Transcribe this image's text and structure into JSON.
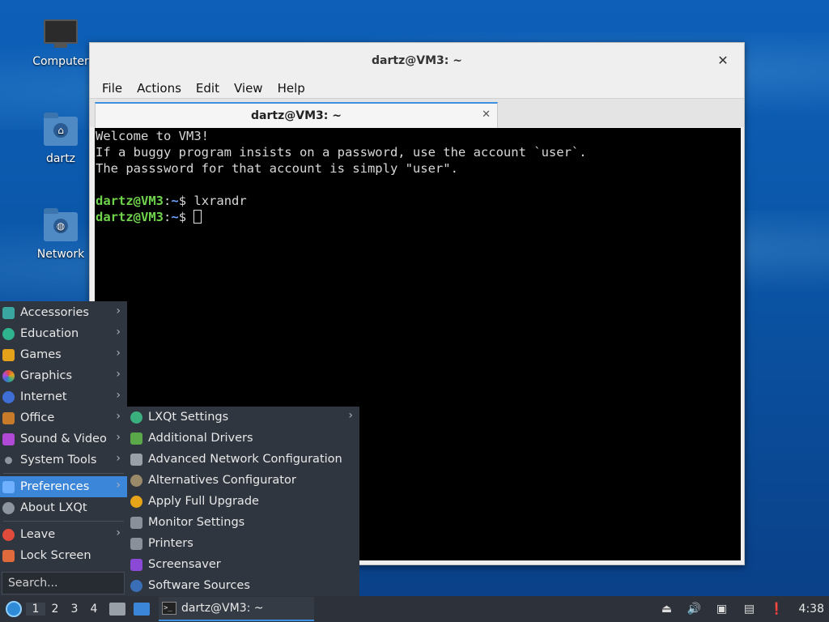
{
  "desktop": {
    "icons": [
      {
        "label": "Computer",
        "icon": "computer-icon"
      },
      {
        "label": "dartz",
        "icon": "home-folder-icon"
      },
      {
        "label": "Network",
        "icon": "network-folder-icon"
      }
    ]
  },
  "window": {
    "title": "dartz@VM3: ~",
    "menu": [
      "File",
      "Actions",
      "Edit",
      "View",
      "Help"
    ],
    "tab_title": "dartz@VM3: ~",
    "terminal": {
      "lines": [
        "Welcome to VM3!",
        "If a buggy program insists on a password, use the account `user`.",
        "The passsword for that account is simply \"user\"."
      ],
      "prompt_user": "dartz@VM3",
      "prompt_sep": ":",
      "prompt_path": "~",
      "prompt_symbol": "$",
      "command": "lxrandr"
    }
  },
  "start_menu": {
    "categories": [
      {
        "label": "Accessories",
        "icon": "accessories-icon",
        "color": "#3aa6a0"
      },
      {
        "label": "Education",
        "icon": "education-icon",
        "color": "#2fb38f"
      },
      {
        "label": "Games",
        "icon": "games-icon",
        "color": "#e3a21a"
      },
      {
        "label": "Graphics",
        "icon": "graphics-icon",
        "color": "#d84b8b"
      },
      {
        "label": "Internet",
        "icon": "internet-icon",
        "color": "#3f6fd6"
      },
      {
        "label": "Office",
        "icon": "office-icon",
        "color": "#c67a2a"
      },
      {
        "label": "Sound & Video",
        "icon": "sound-video-icon",
        "color": "#b04ad6"
      },
      {
        "label": "System Tools",
        "icon": "system-tools-icon",
        "color": "#8d96a0"
      }
    ],
    "preferences": {
      "label": "Preferences",
      "icon": "preferences-icon",
      "color": "#6fb0ff"
    },
    "about": {
      "label": "About LXQt",
      "icon": "info-icon",
      "color": "#8d96a0"
    },
    "leave": {
      "label": "Leave",
      "icon": "power-icon",
      "color": "#e04b3b"
    },
    "lock": {
      "label": "Lock Screen",
      "icon": "lock-icon",
      "color": "#e06a3b"
    },
    "search_placeholder": "Search..."
  },
  "preferences_submenu": [
    {
      "label": "LXQt Settings",
      "icon": "lxqt-settings-icon",
      "color": "#3ab07f",
      "submenu": true
    },
    {
      "label": "Additional Drivers",
      "icon": "drivers-icon",
      "color": "#5aa84a"
    },
    {
      "label": "Advanced Network Configuration",
      "icon": "network-config-icon",
      "color": "#9aa0a8"
    },
    {
      "label": "Alternatives Configurator",
      "icon": "alternatives-icon",
      "color": "#9a8a6a"
    },
    {
      "label": "Apply Full Upgrade",
      "icon": "upgrade-icon",
      "color": "#e8a418"
    },
    {
      "label": "Monitor Settings",
      "icon": "monitor-icon",
      "color": "#8a9099"
    },
    {
      "label": "Printers",
      "icon": "printer-icon",
      "color": "#8a9099"
    },
    {
      "label": "Screensaver",
      "icon": "screensaver-icon",
      "color": "#8a4ad6"
    },
    {
      "label": "Software Sources",
      "icon": "software-sources-icon",
      "color": "#3a6fb8"
    }
  ],
  "taskbar": {
    "desktops": [
      "1",
      "2",
      "3",
      "4"
    ],
    "task_title": "dartz@VM3: ~",
    "clock": "4:38"
  }
}
